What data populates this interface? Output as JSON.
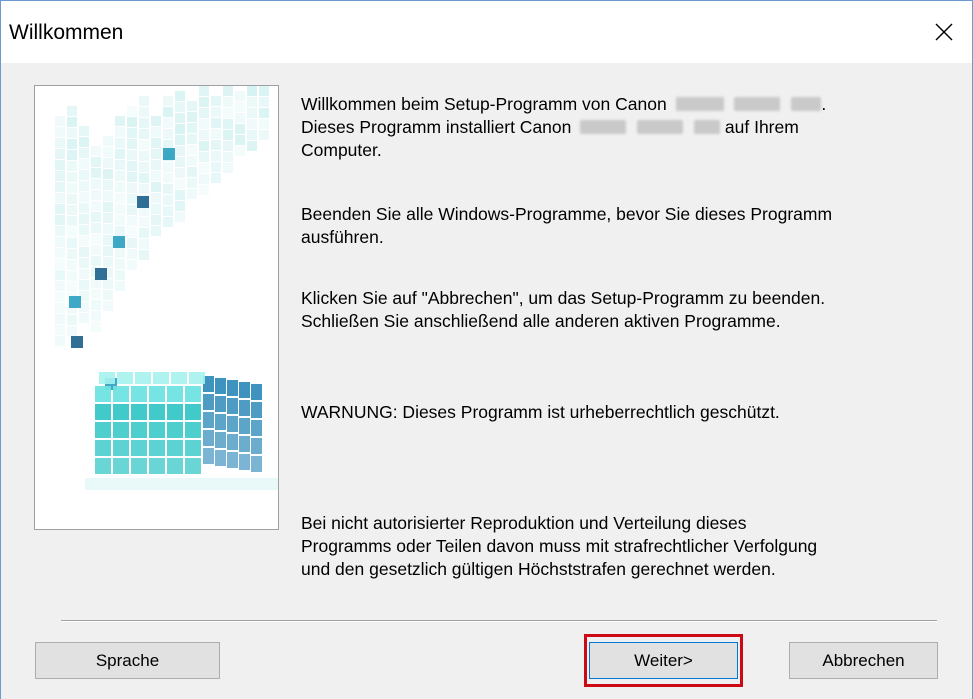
{
  "window": {
    "title": "Willkommen"
  },
  "content": {
    "paragraph1_part1": "Willkommen beim Setup-Programm von Canon",
    "paragraph1_part1_end": ".",
    "paragraph1_part2_start": "Dieses Programm installiert Canon",
    "paragraph1_part2_end": "auf Ihrem",
    "paragraph1_part3": "Computer.",
    "paragraph2_line1": "Beenden Sie alle Windows-Programme, bevor Sie dieses Programm",
    "paragraph2_line2": "ausführen.",
    "paragraph3_line1": "Klicken Sie auf \"Abbrechen\", um das Setup-Programm zu beenden.",
    "paragraph3_line2": "Schließen Sie anschließend alle anderen aktiven Programme.",
    "warning": "WARNUNG: Dieses Programm ist urheberrechtlich geschützt.",
    "legal_line1": "Bei nicht autorisierter Reproduktion und Verteilung dieses",
    "legal_line2": "Programms oder Teilen davon muss mit strafrechtlicher Verfolgung",
    "legal_line3": "und den gesetzlich gültigen Höchststrafen gerechnet werden."
  },
  "buttons": {
    "sprache": "Sprache",
    "weiter": "Weiter>",
    "abbrechen": "Abbrechen"
  },
  "icons": {
    "close": "close-icon"
  },
  "colors": {
    "highlight": "#cc0a16",
    "cube_primary": "#2bc4c4"
  }
}
